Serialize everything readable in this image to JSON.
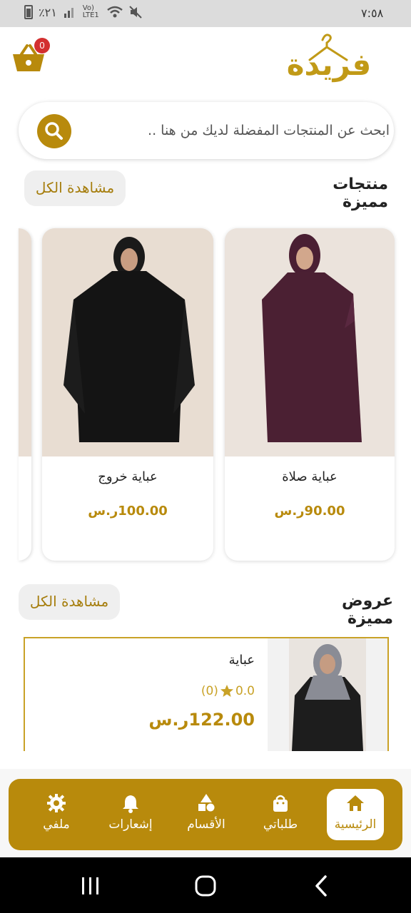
{
  "status_bar": {
    "time": "٧:٥٨",
    "battery": "٪٢١",
    "network": "Vo) LTE1"
  },
  "header": {
    "logo_text": "فريدة",
    "cart_count": "0"
  },
  "search": {
    "placeholder": "ابحث عن المنتجات المفضلة لديك من هنا .."
  },
  "featured_products": {
    "title": "منتجات مميزة",
    "view_all": "مشاهدة الكل",
    "items": [
      {
        "name": "عباية صلاة",
        "price": "90.00ر.س"
      },
      {
        "name": "عباية خروج",
        "price": "100.00ر.س"
      }
    ]
  },
  "featured_offers": {
    "title": "عروض مميزة",
    "view_all": "مشاهدة الكل",
    "items": [
      {
        "name": "عباية",
        "rating": "0.0",
        "reviews": "(0)",
        "price": "122.00ر.س"
      }
    ]
  },
  "bottom_nav": {
    "items": [
      {
        "label": "الرئيسية",
        "icon": "home-icon",
        "active": true
      },
      {
        "label": "طلباتي",
        "icon": "shopping-bag-icon",
        "active": false
      },
      {
        "label": "الأقسام",
        "icon": "categories-icon",
        "active": false
      },
      {
        "label": "إشعارات",
        "icon": "bell-icon",
        "active": false
      },
      {
        "label": "ملفي",
        "icon": "gear-icon",
        "active": false
      }
    ]
  },
  "colors": {
    "accent": "#b88a0c",
    "logo": "#c19a17",
    "badge": "#d32f2f"
  }
}
